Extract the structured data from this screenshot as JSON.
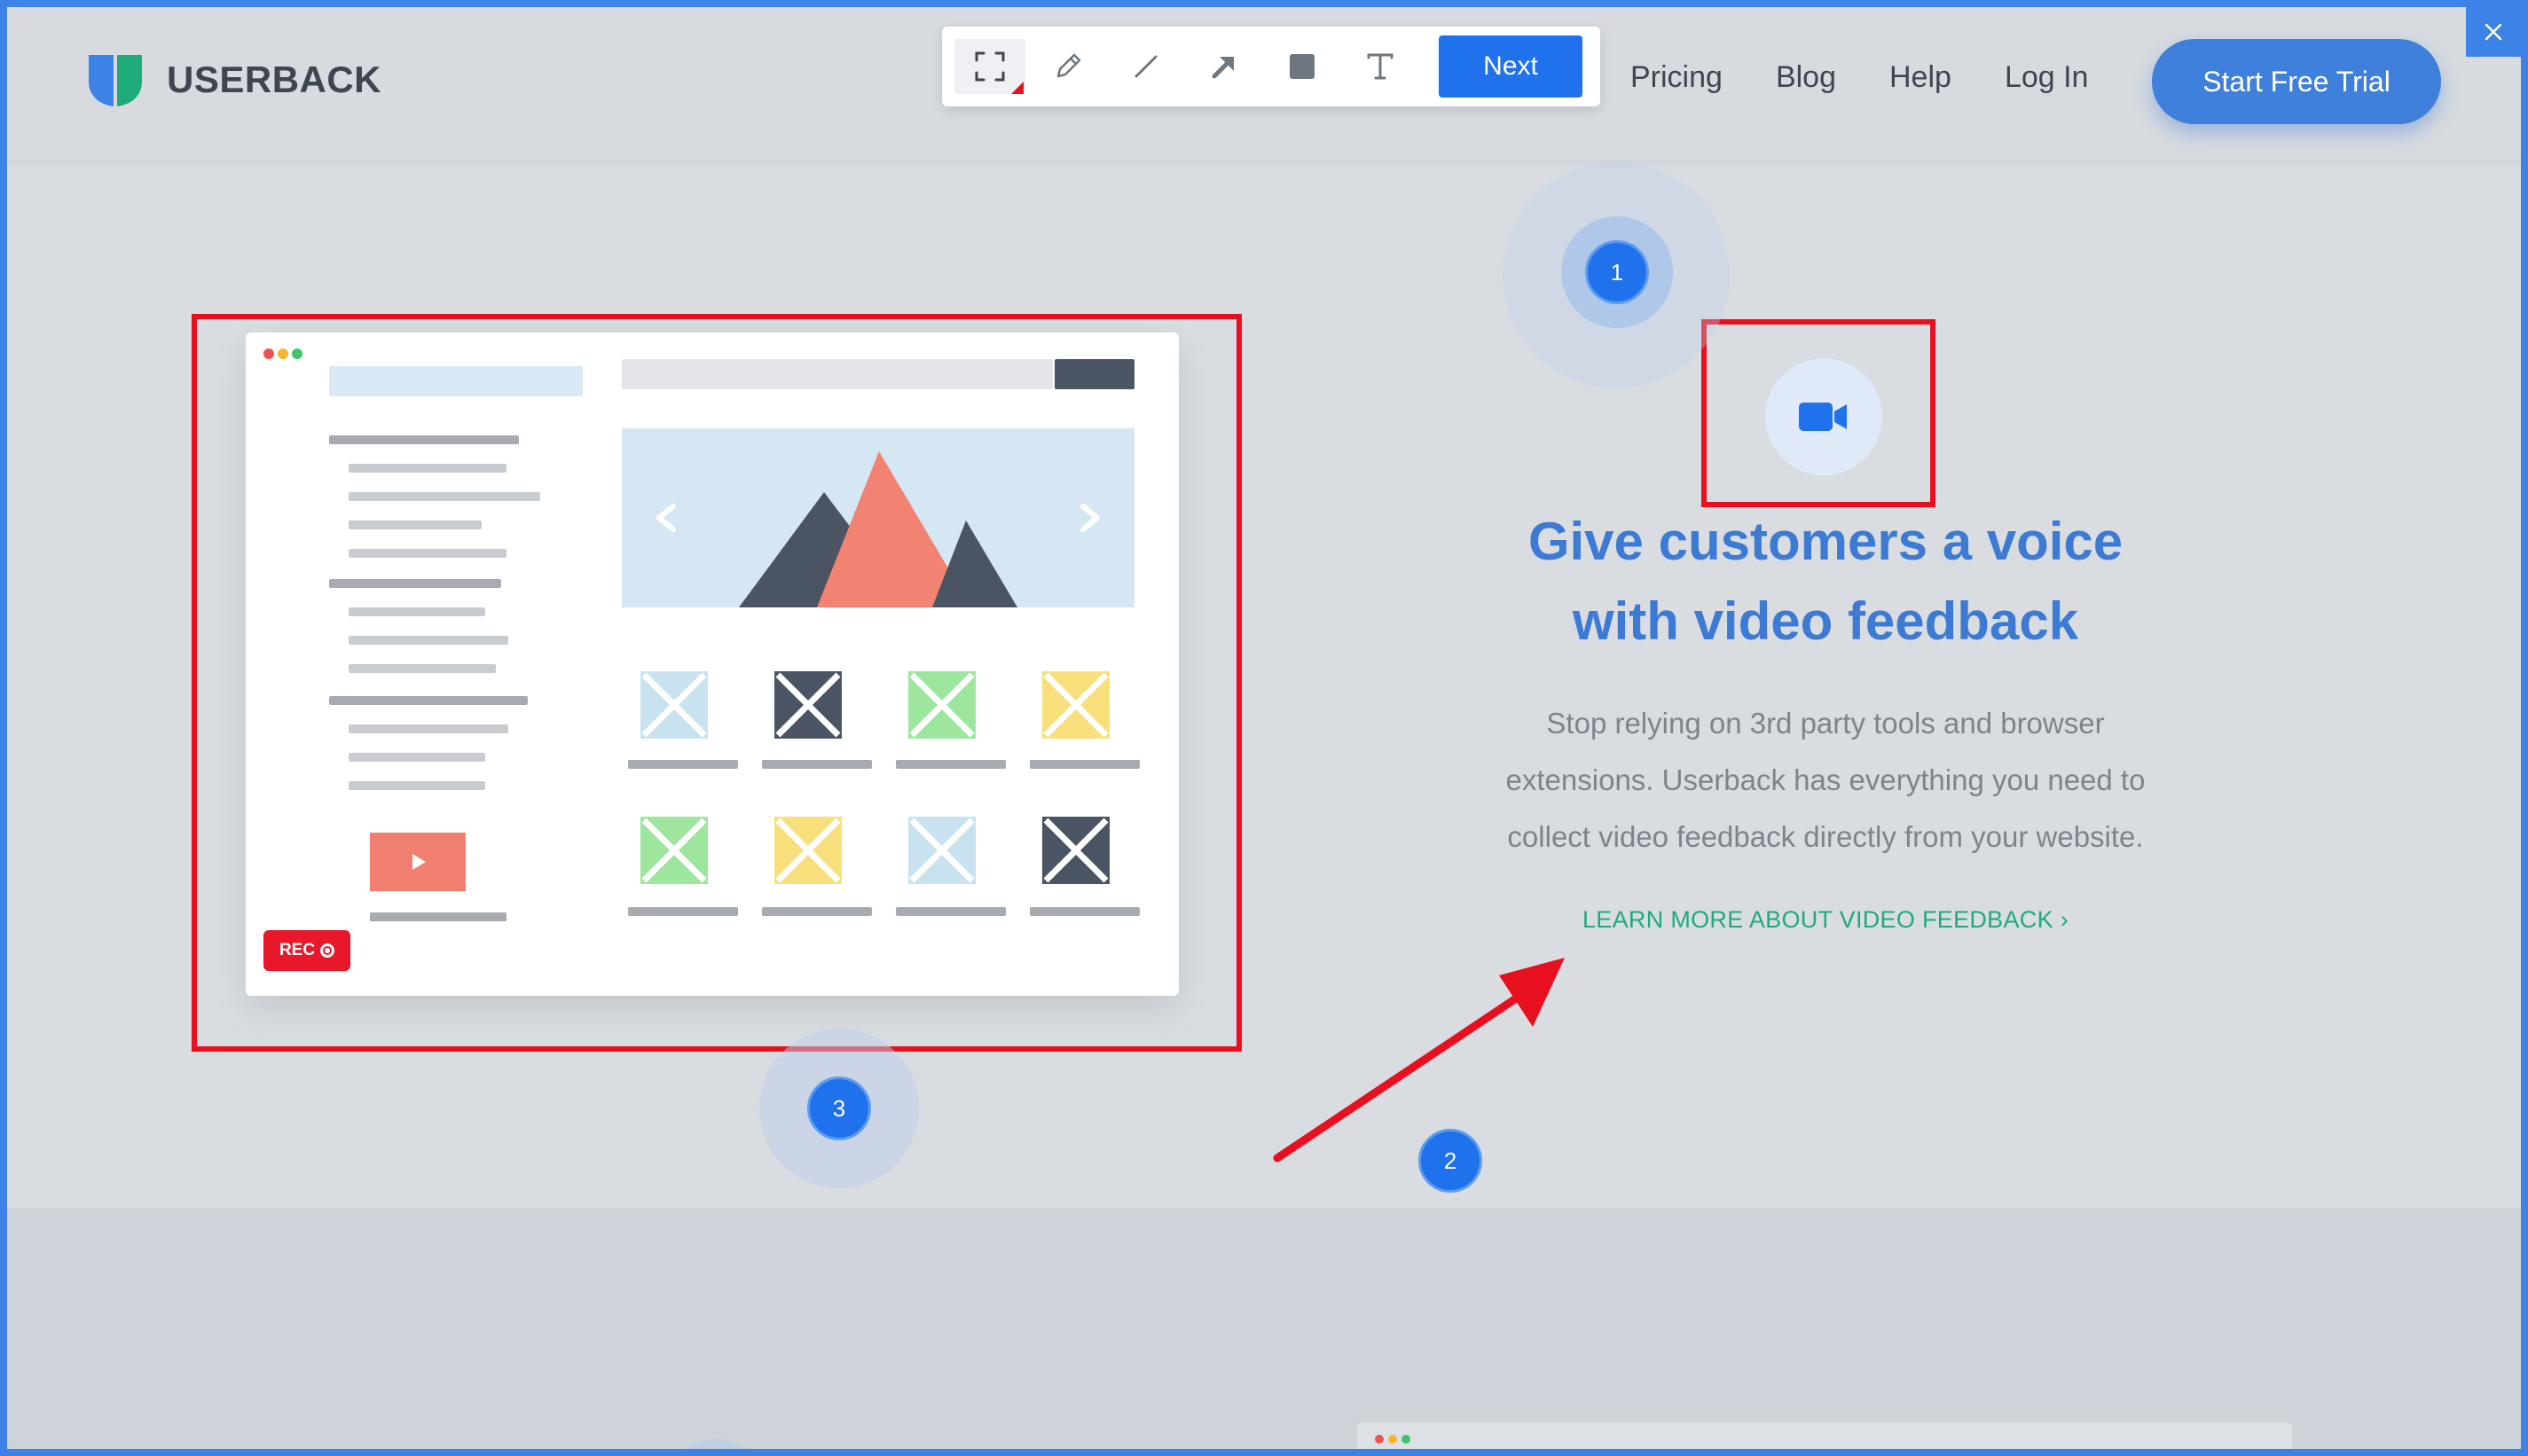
{
  "brand": {
    "name": "USERBACK",
    "mark_left": "#3d82e6",
    "mark_right": "#1fab79"
  },
  "nav": {
    "items": [
      "Pricing",
      "Blog",
      "Help",
      "Log In"
    ],
    "cta": "Start Free Trial"
  },
  "toolbar": {
    "tools": [
      "crop-icon",
      "pencil-icon",
      "line-icon",
      "arrow-icon",
      "rectangle-icon",
      "text-icon"
    ],
    "active_tool": "crop-icon",
    "next_label": "Next"
  },
  "feature": {
    "headline_line1": "Give customers a voice",
    "headline_line2": "with video feedback",
    "desc_line1": "Stop relying on 3rd party tools and browser",
    "desc_line2": "extensions. Userback has everything you need to",
    "desc_line3": "collect video feedback directly from your website.",
    "link": "LEARN MORE ABOUT VIDEO FEEDBACK",
    "link_chevron": "›"
  },
  "mockup": {
    "rec_label": "REC"
  },
  "annotations": {
    "marker_1": "1",
    "marker_2": "2",
    "marker_3": "3"
  },
  "colors": {
    "accent": "#3d82e6",
    "annotation_red": "#e8101e",
    "headline_blue": "#3d7ad4",
    "link_green": "#1fab79"
  }
}
